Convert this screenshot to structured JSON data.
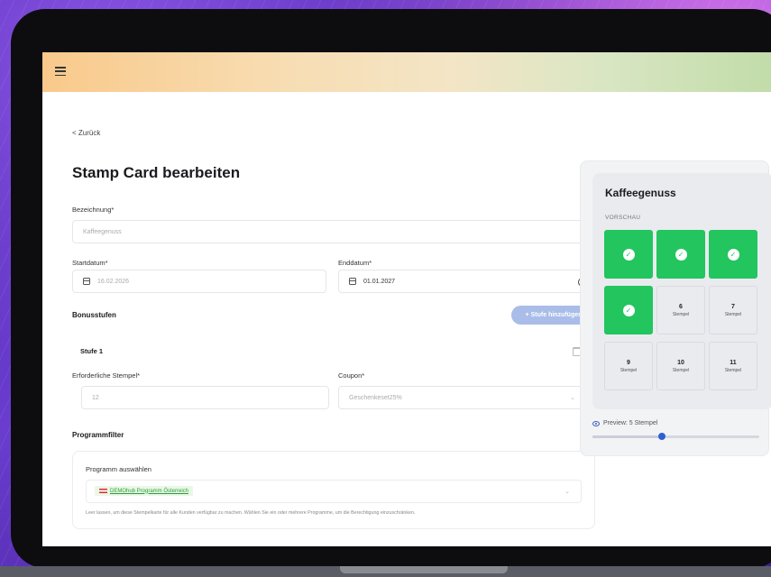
{
  "nav": {
    "back_label": "< Zurück"
  },
  "page": {
    "title": "Stamp Card bearbeiten",
    "more_label": "··"
  },
  "form": {
    "name_label": "Bezeichnung*",
    "name_value": "Kaffeegenuss",
    "start_label": "Startdatum*",
    "start_value": "16.02.2026",
    "end_label": "Enddatum*",
    "end_value": "01.01.2027",
    "bonus_title": "Bonusstufen",
    "add_button": "+ Stufe hinzufügen",
    "stufe": {
      "title": "Stufe 1",
      "stamps_label": "Erforderliche Stempel*",
      "stamps_value": "12",
      "coupon_label": "Coupon*",
      "coupon_value": "Geschenkeset25%"
    },
    "filter_title": "Programmfilter",
    "program": {
      "label": "Programm auswählen",
      "chip": "DEMOhub Programm Österreich",
      "hint": "Leer lassen, um diese Stempelkarte für alle Kunden verfügbar zu machen. Wählen Sie ein oder mehrere Programme, um die Berechtigung einzuschränken."
    }
  },
  "preview": {
    "title": "Kaffeegenuss",
    "subtitle": "VORSCHAU",
    "stamp_label": "Stempel",
    "stamps": [
      {
        "num": "",
        "filled": true
      },
      {
        "num": "",
        "filled": true
      },
      {
        "num": "",
        "filled": true
      },
      {
        "num": "",
        "filled": true
      },
      {
        "num": "6",
        "filled": false
      },
      {
        "num": "7",
        "filled": false
      },
      {
        "num": "9",
        "filled": false
      },
      {
        "num": "10",
        "filled": false
      },
      {
        "num": "11",
        "filled": false
      }
    ],
    "slider_label": "Preview: 5 Stempel",
    "slider_value": 5,
    "slider_max": 12
  },
  "colors": {
    "stamp_filled": "#22c55e",
    "button": "#a9bde8",
    "slider_knob": "#2d5fd4"
  }
}
